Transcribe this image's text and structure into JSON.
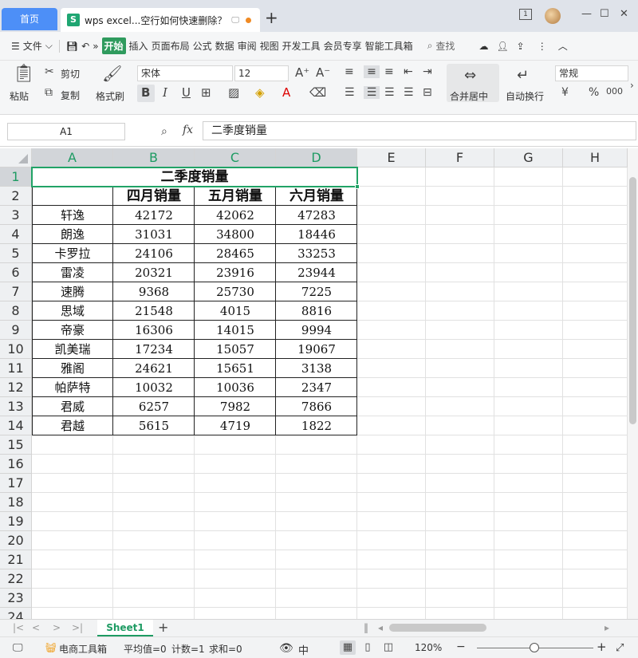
{
  "titlebar": {
    "home_tab": "首页",
    "doc_icon": "S",
    "doc_title": "wps excel...空行如何快速删除？",
    "new_tab": "+",
    "window_badge": "1"
  },
  "menubar": {
    "file": "文件",
    "items": [
      "开始",
      "插入",
      "页面布局",
      "公式",
      "数据",
      "审阅",
      "视图",
      "开发工具",
      "会员专享",
      "智能工具箱"
    ],
    "search": "查找"
  },
  "ribbon": {
    "paste": "粘贴",
    "cut": "剪切",
    "copy": "复制",
    "format_painter": "格式刷",
    "font_name": "宋体",
    "font_size": "12",
    "merge_center": "合并居中",
    "wrap_text": "自动换行",
    "number_format": "常规"
  },
  "formulabar": {
    "cell_ref": "A1",
    "fx": "fx",
    "content": "二季度销量"
  },
  "sheet": {
    "columns": [
      "A",
      "B",
      "C",
      "D",
      "E",
      "F",
      "G",
      "H"
    ],
    "rows": [
      "1",
      "2",
      "3",
      "4",
      "5",
      "6",
      "7",
      "8",
      "9",
      "10",
      "11",
      "12",
      "13",
      "14",
      "15",
      "16",
      "17",
      "18",
      "19",
      "20",
      "21",
      "22",
      "23",
      "24"
    ],
    "selected_cell": "A1",
    "title": "二季度销量",
    "headers": [
      "",
      "四月销量",
      "五月销量",
      "六月销量"
    ],
    "data": [
      [
        "轩逸",
        "42172",
        "42062",
        "47283"
      ],
      [
        "朗逸",
        "31031",
        "34800",
        "18446"
      ],
      [
        "卡罗拉",
        "24106",
        "28465",
        "33253"
      ],
      [
        "雷凌",
        "20321",
        "23916",
        "23944"
      ],
      [
        "速腾",
        "9368",
        "25730",
        "7225"
      ],
      [
        "思域",
        "21548",
        "4015",
        "8816"
      ],
      [
        "帝豪",
        "16306",
        "14015",
        "9994"
      ],
      [
        "凯美瑞",
        "17234",
        "15057",
        "19067"
      ],
      [
        "雅阁",
        "24621",
        "15651",
        "3138"
      ],
      [
        "帕萨特",
        "10032",
        "10036",
        "2347"
      ],
      [
        "君威",
        "6257",
        "7982",
        "7866"
      ],
      [
        "君越",
        "5615",
        "4719",
        "1822"
      ]
    ]
  },
  "sheettabs": {
    "active": "Sheet1",
    "add": "+"
  },
  "statusbar": {
    "ecommerce": "电商工具箱",
    "average": "平均值=0",
    "count": "计数=1",
    "sum": "求和=0",
    "zoom": "120%",
    "minus": "−",
    "plus": "+"
  },
  "colors": {
    "accent": "#1e9b63",
    "home_tab": "#4d8ff7",
    "active_menu": "#2f9b5e"
  }
}
